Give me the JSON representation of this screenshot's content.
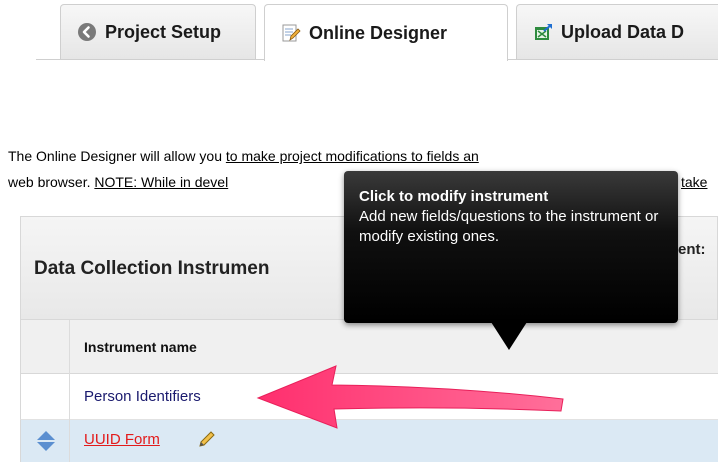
{
  "tabs": [
    {
      "label": "Project Setup",
      "icon": "back-circle-icon",
      "active": false
    },
    {
      "label": "Online Designer",
      "icon": "designer-pencil-icon",
      "active": true
    },
    {
      "label": "Upload Data D",
      "icon": "spreadsheet-upload-icon",
      "active": false
    }
  ],
  "description": {
    "line1_plain": "The Online Designer will allow you ",
    "line1_link": "to make project modifications to fields an",
    "line2_plain": "web browser. ",
    "line2_link_a": "NOTE: While in devel",
    "line2_link_b": "take"
  },
  "table": {
    "title": "Data Collection Instrumen",
    "header_right": "ent:",
    "column_header": "Instrument name",
    "rows": [
      {
        "name": "Person Identifiers"
      },
      {
        "name": "UUID Form"
      }
    ]
  },
  "tooltip": {
    "title": "Click to modify instrument",
    "body": "Add new fields/questions to the instrument or modify existing ones."
  },
  "colors": {
    "tooltip_bg": "#000000",
    "arrow": "#ff3e7a",
    "selected_row": "#dbe9f4",
    "link_red": "#e31a1a"
  }
}
